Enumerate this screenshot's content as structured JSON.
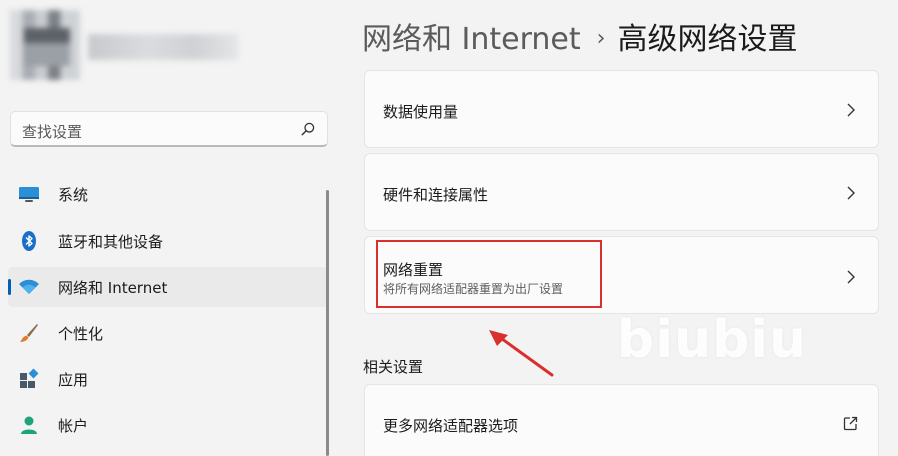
{
  "sidebar": {
    "search_placeholder": "查找设置",
    "items": [
      {
        "label": "系统",
        "icon": "monitor-icon"
      },
      {
        "label": "蓝牙和其他设备",
        "icon": "bluetooth-icon"
      },
      {
        "label": "网络和 Internet",
        "icon": "wifi-icon",
        "active": true
      },
      {
        "label": "个性化",
        "icon": "brush-icon"
      },
      {
        "label": "应用",
        "icon": "apps-icon"
      },
      {
        "label": "帐户",
        "icon": "account-icon"
      }
    ]
  },
  "breadcrumb": {
    "parent": "网络和 Internet",
    "separator": "›",
    "current": "高级网络设置"
  },
  "cards": [
    {
      "title": "数据使用量"
    },
    {
      "title": "硬件和连接属性"
    },
    {
      "title": "网络重置",
      "subtitle": "将所有网络适配器重置为出厂设置"
    }
  ],
  "related": {
    "heading": "相关设置",
    "items": [
      {
        "title": "更多网络适配器选项"
      }
    ]
  },
  "watermark": "biubiu",
  "colors": {
    "accent": "#005fb8",
    "highlight": "#d9302e"
  }
}
